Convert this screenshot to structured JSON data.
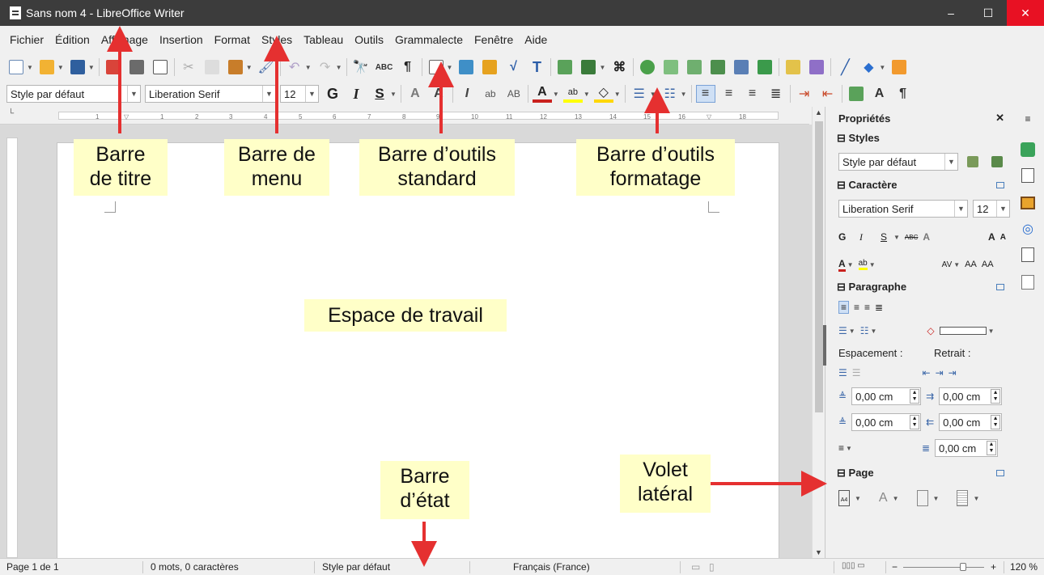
{
  "window": {
    "title": "Sans nom 4 - LibreOffice Writer",
    "controls": {
      "minimize": "–",
      "maximize": "☐",
      "close": "✕"
    }
  },
  "menubar": {
    "items": [
      "Fichier",
      "Édition",
      "Affichage",
      "Insertion",
      "Format",
      "Styles",
      "Tableau",
      "Outils",
      "Grammalecte",
      "Fenêtre",
      "Aide"
    ]
  },
  "formatting_toolbar": {
    "paragraph_style": "Style par défaut",
    "font_name": "Liberation Serif",
    "font_size": "12",
    "bold_glyph": "G",
    "italic_glyph": "I",
    "underline_glyph": "S"
  },
  "ruler": {
    "ticks": [
      "1",
      "1",
      "2",
      "3",
      "4",
      "5",
      "6",
      "7",
      "8",
      "9",
      "10",
      "11",
      "12",
      "13",
      "14",
      "15",
      "16",
      "17",
      "18"
    ]
  },
  "sidebar": {
    "title": "Propriétés",
    "close_glyph": "✕",
    "styles": {
      "heading": "Styles",
      "value": "Style par défaut"
    },
    "character": {
      "heading": "Caractère",
      "font_name": "Liberation Serif",
      "font_size": "12",
      "bold_glyph": "G",
      "italic_glyph": "I",
      "underline_glyph": "S"
    },
    "paragraph": {
      "heading": "Paragraphe",
      "spacing_label": "Espacement :",
      "indent_label": "Retrait :",
      "above": "0,00 cm",
      "before_text": "0,00 cm",
      "below": "0,00 cm",
      "after_text": "0,00 cm",
      "first_line": "0,00 cm"
    },
    "page": {
      "heading": "Page"
    }
  },
  "statusbar": {
    "page": "Page 1 de 1",
    "words": "0 mots, 0 caractères",
    "style": "Style par défaut",
    "language": "Français (France)",
    "zoom": "120 %"
  },
  "annotations": {
    "title_bar": [
      "Barre",
      "de titre"
    ],
    "menu_bar": [
      "Barre de",
      "menu"
    ],
    "standard_toolbar": [
      "Barre d’outils",
      "standard"
    ],
    "formatting_toolbar": [
      "Barre d’outils",
      "formatage"
    ],
    "workspace": "Espace de travail",
    "status_bar": [
      "Barre",
      "d’état"
    ],
    "sidebar": [
      "Volet",
      "latéral"
    ]
  },
  "colors": {
    "titlebar_bg": "#3c3c3c",
    "close_button": "#e81123",
    "callout_bg": "#ffffc8",
    "arrow": "#e53030",
    "selected_blue": "#4a7ebb"
  }
}
